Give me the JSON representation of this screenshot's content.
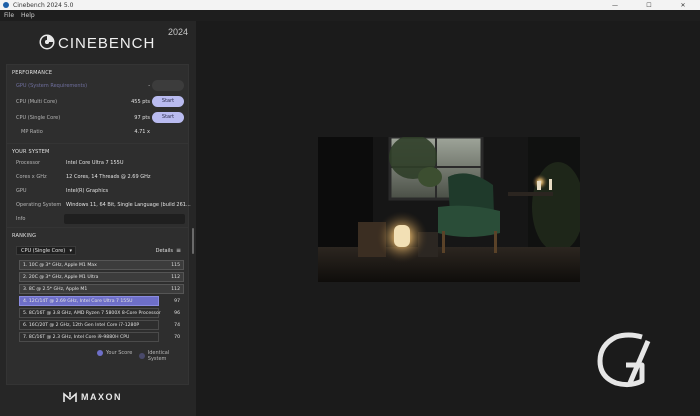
{
  "window": {
    "title": "Cinebench 2024 5.0",
    "minimize": "—",
    "maximize": "☐",
    "close": "✕"
  },
  "menu": [
    "File",
    "Help"
  ],
  "logo": {
    "text": "CINEBENCH",
    "year": "2024"
  },
  "performance": {
    "title": "PERFORMANCE",
    "gpu_label": "GPU (System Requirements)",
    "gpu_value": "-",
    "rows": [
      {
        "label": "CPU (Multi Core)",
        "value": "455 pts",
        "button": "Start"
      },
      {
        "label": "CPU (Single Core)",
        "value": "97 pts",
        "button": "Start"
      },
      {
        "label": "MP Ratio",
        "value": "4.71 x"
      }
    ]
  },
  "system": {
    "title": "YOUR SYSTEM",
    "rows": [
      {
        "label": "Processor",
        "value": "Intel Core Ultra 7 155U"
      },
      {
        "label": "Cores x GHz",
        "value": "12 Cores, 14 Threads @ 2.69 GHz"
      },
      {
        "label": "GPU",
        "value": "Intel(R) Graphics"
      },
      {
        "label": "Operating System",
        "value": "Windows 11, 64 Bit, Single Language (build 261..."
      },
      {
        "label": "Info",
        "value": ""
      }
    ]
  },
  "ranking": {
    "title": "RANKING",
    "dropdown": "CPU (Single Core)",
    "details": "Details",
    "rows": [
      {
        "name": "1. 10C @ 3* GHz, Apple M1 Max",
        "score": "115"
      },
      {
        "name": "2. 20C @ 3* GHz, Apple M1 Ultra",
        "score": "112"
      },
      {
        "name": "3. 8C @ 2.5* GHz, Apple M1",
        "score": "112"
      },
      {
        "name": "4. 12C/14T @ 2.69 GHz, Intel Core Ultra 7 155U",
        "score": "97"
      },
      {
        "name": "5. 8C/16T @ 3.8 GHz, AMD Ryzen 7 5800X 8-Core Processor",
        "score": "96"
      },
      {
        "name": "6. 16C/20T @ 2 GHz, 12th Gen Intel Core i7-1280P",
        "score": "74"
      },
      {
        "name": "7. 8C/16T @ 2.3 GHz, Intel Core i9-9880H CPU",
        "score": "70"
      }
    ],
    "legend": {
      "your_score": "Your Score",
      "identical": "Identical System"
    }
  },
  "brand": {
    "maxon": "MAXON"
  },
  "colors": {
    "accent": "#b9bbf0",
    "highlight": "#6e6fc8",
    "panel": "#2e2e2e"
  }
}
